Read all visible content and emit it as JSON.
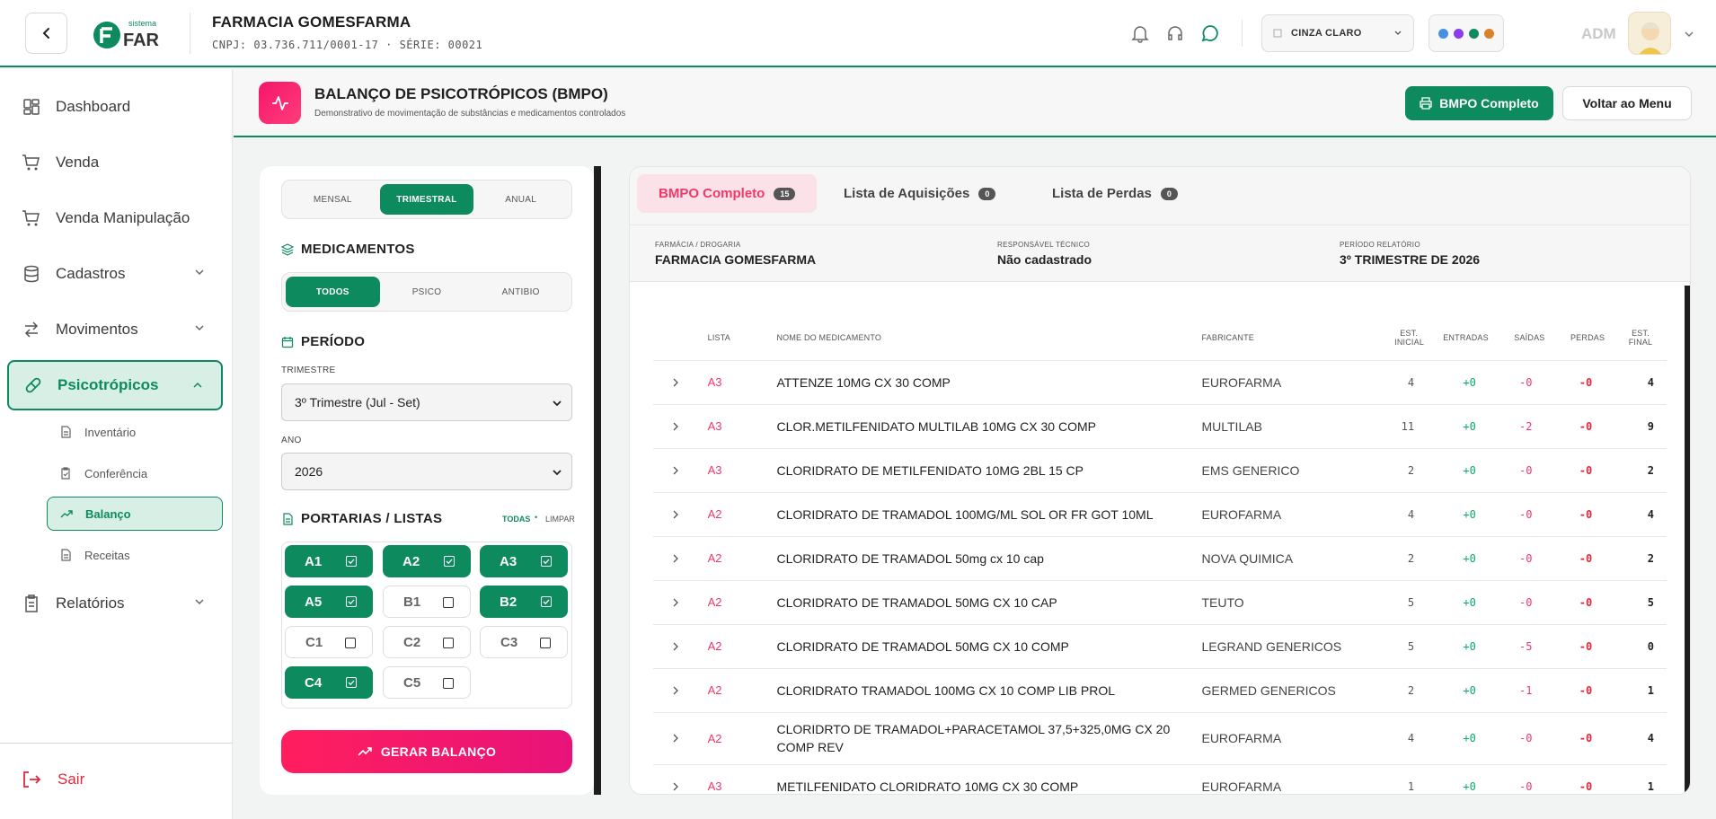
{
  "header": {
    "logo_top": "sistema",
    "logo_text": "FAR",
    "company_name": "FARMACIA GOMESFARMA",
    "cnpj_line": "CNPJ: 03.736.711/0001-17 · SÉRIE: 00021",
    "theme_label": "CINZA CLARO",
    "theme_colors": [
      "#4a90e2",
      "#8b3de8",
      "#0e8a5f",
      "#d9822b"
    ],
    "user": "ADM"
  },
  "sidebar": {
    "items": [
      {
        "label": "Dashboard",
        "icon": "dashboard-icon"
      },
      {
        "label": "Venda",
        "icon": "cart-icon"
      },
      {
        "label": "Venda Manipulação",
        "icon": "cart-icon"
      },
      {
        "label": "Cadastros",
        "icon": "database-icon"
      },
      {
        "label": "Movimentos",
        "icon": "arrows-icon"
      },
      {
        "label": "Psicotrópicos",
        "icon": "pill-icon"
      },
      {
        "label": "Relatórios",
        "icon": "clipboard-icon"
      }
    ],
    "subitems": [
      {
        "label": "Inventário"
      },
      {
        "label": "Conferência"
      },
      {
        "label": "Balanço"
      },
      {
        "label": "Receitas"
      }
    ],
    "logout": "Sair"
  },
  "page": {
    "title": "BALANÇO DE PSICOTRÓPICOS (BMPO)",
    "subtitle": "Demonstrativo de movimentação de substâncias e medicamentos controlados",
    "btn_bmpo": "BMPO Completo",
    "btn_voltar": "Voltar ao Menu"
  },
  "filters": {
    "period_tabs": [
      "MENSAL",
      "TRIMESTRAL",
      "ANUAL"
    ],
    "period_selected": "TRIMESTRAL",
    "med_title": "MEDICAMENTOS",
    "med_tabs": [
      "TODOS",
      "PSICO",
      "ANTIBIO"
    ],
    "med_selected": "TODOS",
    "periodo_title": "PERÍODO",
    "trimestre_label": "TRIMESTRE",
    "trimestre_value": "3º Trimestre (Jul - Set)",
    "ano_label": "ANO",
    "ano_value": "2026",
    "portarias_title": "PORTARIAS / LISTAS",
    "todas": "TODAS",
    "limpar": "LIMPAR",
    "lists": [
      {
        "label": "A1",
        "checked": true
      },
      {
        "label": "A2",
        "checked": true
      },
      {
        "label": "A3",
        "checked": true
      },
      {
        "label": "A5",
        "checked": true
      },
      {
        "label": "B1",
        "checked": false
      },
      {
        "label": "B2",
        "checked": true
      },
      {
        "label": "C1",
        "checked": false
      },
      {
        "label": "C2",
        "checked": false
      },
      {
        "label": "C3",
        "checked": false
      },
      {
        "label": "C4",
        "checked": true
      },
      {
        "label": "C5",
        "checked": false
      }
    ],
    "gerar": "GERAR BALANÇO"
  },
  "tabs": [
    {
      "label": "BMPO Completo",
      "count": "15"
    },
    {
      "label": "Lista de Aquisições",
      "count": "0"
    },
    {
      "label": "Lista de Perdas",
      "count": "0"
    }
  ],
  "info": {
    "farmacia_label": "FARMÁCIA / DROGARIA",
    "farmacia_value": "FARMACIA GOMESFARMA",
    "resp_label": "RESPONSÁVEL TÉCNICO",
    "resp_value": "Não cadastrado",
    "periodo_label": "PERÍODO RELATÓRIO",
    "periodo_value": "3º TRIMESTRE DE 2026"
  },
  "table": {
    "headers": [
      "LISTA",
      "NOME DO MEDICAMENTO",
      "FABRICANTE",
      "EST. INICIAL",
      "ENTRADAS",
      "SAÍDAS",
      "PERDAS",
      "EST. FINAL"
    ],
    "rows": [
      {
        "lista": "A3",
        "nome": "ATTENZE 10MG CX 30 COMP",
        "fabricante": "EUROFARMA",
        "inicial": "4",
        "entradas": "+0",
        "saidas": "-0",
        "perdas": "-0",
        "final": "4"
      },
      {
        "lista": "A3",
        "nome": "CLOR.METILFENIDATO MULTILAB 10MG CX 30 COMP",
        "fabricante": "MULTILAB",
        "inicial": "11",
        "entradas": "+0",
        "saidas": "-2",
        "perdas": "-0",
        "final": "9"
      },
      {
        "lista": "A3",
        "nome": "CLORIDRATO DE METILFENIDATO 10MG 2BL 15 CP",
        "fabricante": "EMS GENERICO",
        "inicial": "2",
        "entradas": "+0",
        "saidas": "-0",
        "perdas": "-0",
        "final": "2"
      },
      {
        "lista": "A2",
        "nome": "CLORIDRATO DE TRAMADOL 100MG/ML SOL OR FR GOT 10ML",
        "fabricante": "EUROFARMA",
        "inicial": "4",
        "entradas": "+0",
        "saidas": "-0",
        "perdas": "-0",
        "final": "4"
      },
      {
        "lista": "A2",
        "nome": "CLORIDRATO DE TRAMADOL 50mg cx 10 cap",
        "fabricante": "NOVA QUIMICA",
        "inicial": "2",
        "entradas": "+0",
        "saidas": "-0",
        "perdas": "-0",
        "final": "2"
      },
      {
        "lista": "A2",
        "nome": "CLORIDRATO DE TRAMADOL 50MG CX 10 CAP",
        "fabricante": "TEUTO",
        "inicial": "5",
        "entradas": "+0",
        "saidas": "-0",
        "perdas": "-0",
        "final": "5"
      },
      {
        "lista": "A2",
        "nome": "CLORIDRATO DE TRAMADOL 50MG CX 10 COMP",
        "fabricante": "LEGRAND GENERICOS",
        "inicial": "5",
        "entradas": "+0",
        "saidas": "-5",
        "perdas": "-0",
        "final": "0"
      },
      {
        "lista": "A2",
        "nome": "CLORIDRATO TRAMADOL 100MG CX 10 COMP LIB PROL",
        "fabricante": "GERMED GENERICOS",
        "inicial": "2",
        "entradas": "+0",
        "saidas": "-1",
        "perdas": "-0",
        "final": "1"
      },
      {
        "lista": "A2",
        "nome": "CLORIDRTO DE TRAMADOL+PARACETAMOL 37,5+325,0MG CX 20 COMP REV",
        "fabricante": "EUROFARMA",
        "inicial": "4",
        "entradas": "+0",
        "saidas": "-0",
        "perdas": "-0",
        "final": "4"
      },
      {
        "lista": "A3",
        "nome": "METILFENIDATO CLORIDRATO 10MG CX 30 COMP",
        "fabricante": "EUROFARMA",
        "inicial": "1",
        "entradas": "+0",
        "saidas": "-0",
        "perdas": "-0",
        "final": "1"
      }
    ]
  }
}
